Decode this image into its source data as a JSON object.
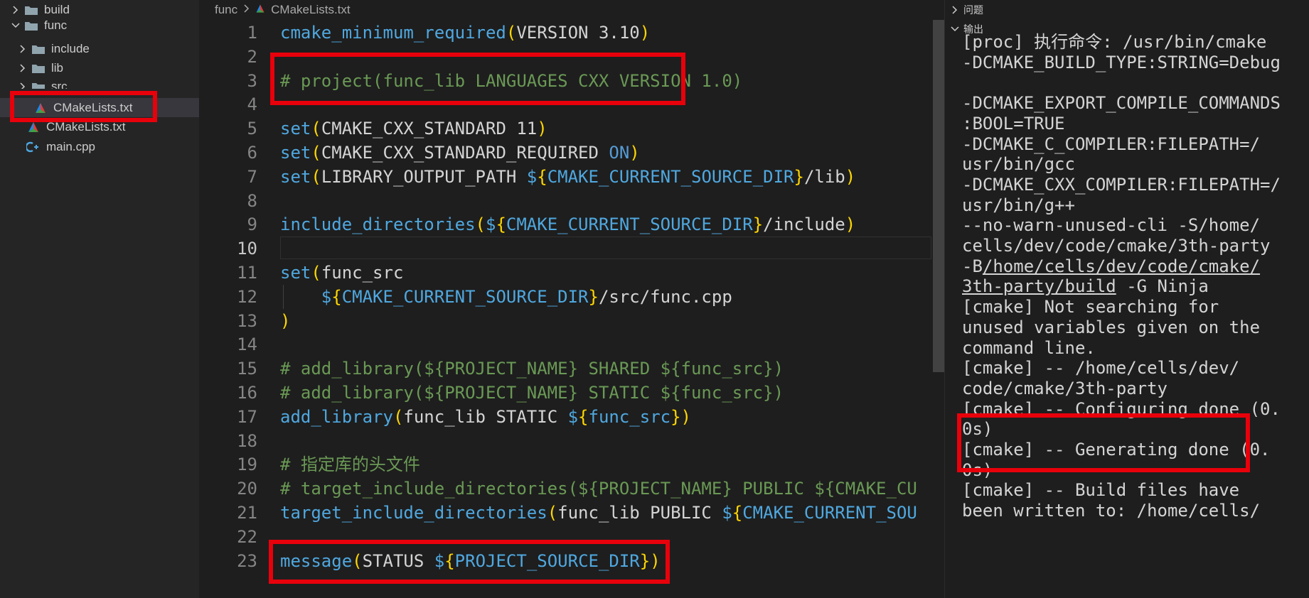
{
  "explorer": {
    "items": [
      {
        "label": "build",
        "type": "folder",
        "expanded": false
      },
      {
        "label": "func",
        "type": "folder",
        "expanded": true
      },
      {
        "label": "include",
        "type": "folder",
        "expanded": false
      },
      {
        "label": "lib",
        "type": "folder",
        "expanded": false
      },
      {
        "label": "src",
        "type": "folder",
        "expanded": false
      },
      {
        "label": "CMakeLists.txt",
        "type": "cmake-file",
        "selected": true
      },
      {
        "label": "CMakeLists.txt",
        "type": "cmake-file"
      },
      {
        "label": "main.cpp",
        "type": "cpp-file"
      }
    ]
  },
  "breadcrumb": {
    "folder": "func",
    "file": "CMakeLists.txt"
  },
  "editor": {
    "active_line": 10,
    "lines": [
      {
        "n": "1",
        "tokens": [
          [
            "fn",
            "cmake_minimum_required"
          ],
          [
            "p",
            "("
          ],
          [
            "tx",
            "VERSION 3.10"
          ],
          [
            "p",
            ")"
          ]
        ]
      },
      {
        "n": "2",
        "tokens": []
      },
      {
        "n": "3",
        "tokens": [
          [
            "cm",
            "# project(func_lib LANGUAGES CXX VERSION 1.0)"
          ]
        ]
      },
      {
        "n": "4",
        "tokens": []
      },
      {
        "n": "5",
        "tokens": [
          [
            "fn",
            "set"
          ],
          [
            "p",
            "("
          ],
          [
            "tx",
            "CMAKE_CXX_STANDARD 11"
          ],
          [
            "p",
            ")"
          ]
        ]
      },
      {
        "n": "6",
        "tokens": [
          [
            "fn",
            "set"
          ],
          [
            "p",
            "("
          ],
          [
            "tx",
            "CMAKE_CXX_STANDARD_REQUIRED "
          ],
          [
            "kw",
            "ON"
          ],
          [
            "p",
            ")"
          ]
        ]
      },
      {
        "n": "7",
        "tokens": [
          [
            "fn",
            "set"
          ],
          [
            "p",
            "("
          ],
          [
            "tx",
            "LIBRARY_OUTPUT_PATH "
          ],
          [
            "dl",
            "$"
          ],
          [
            "p",
            "{"
          ],
          [
            "var",
            "CMAKE_CURRENT_SOURCE_DIR"
          ],
          [
            "p",
            "}"
          ],
          [
            "tx",
            "/lib"
          ],
          [
            "p",
            ")"
          ]
        ]
      },
      {
        "n": "8",
        "tokens": []
      },
      {
        "n": "9",
        "tokens": [
          [
            "fn",
            "include_directories"
          ],
          [
            "p",
            "("
          ],
          [
            "dl",
            "$"
          ],
          [
            "p",
            "{"
          ],
          [
            "var",
            "CMAKE_CURRENT_SOURCE_DIR"
          ],
          [
            "p",
            "}"
          ],
          [
            "tx",
            "/include"
          ],
          [
            "p",
            ")"
          ]
        ]
      },
      {
        "n": "10",
        "tokens": []
      },
      {
        "n": "11",
        "tokens": [
          [
            "fn",
            "set"
          ],
          [
            "p",
            "("
          ],
          [
            "tx",
            "func_src"
          ]
        ]
      },
      {
        "n": "12",
        "tokens": [
          [
            "tx",
            "    "
          ],
          [
            "dl",
            "$"
          ],
          [
            "p",
            "{"
          ],
          [
            "var",
            "CMAKE_CURRENT_SOURCE_DIR"
          ],
          [
            "p",
            "}"
          ],
          [
            "tx",
            "/src/func.cpp"
          ]
        ]
      },
      {
        "n": "13",
        "tokens": [
          [
            "p",
            ")"
          ]
        ]
      },
      {
        "n": "14",
        "tokens": []
      },
      {
        "n": "15",
        "tokens": [
          [
            "cm",
            "# add_library(${PROJECT_NAME} SHARED ${func_src})"
          ]
        ]
      },
      {
        "n": "16",
        "tokens": [
          [
            "cm",
            "# add_library(${PROJECT_NAME} STATIC ${func_src})"
          ]
        ]
      },
      {
        "n": "17",
        "tokens": [
          [
            "fn",
            "add_library"
          ],
          [
            "p",
            "("
          ],
          [
            "tx",
            "func_lib STATIC "
          ],
          [
            "dl",
            "$"
          ],
          [
            "p",
            "{"
          ],
          [
            "var",
            "func_src"
          ],
          [
            "p",
            "}"
          ],
          [
            "p",
            ")"
          ]
        ]
      },
      {
        "n": "18",
        "tokens": []
      },
      {
        "n": "19",
        "tokens": [
          [
            "cm",
            "# 指定库的头文件"
          ]
        ]
      },
      {
        "n": "20",
        "tokens": [
          [
            "cm",
            "# target_include_directories(${PROJECT_NAME} PUBLIC ${CMAKE_CU"
          ]
        ]
      },
      {
        "n": "21",
        "tokens": [
          [
            "fn",
            "target_include_directories"
          ],
          [
            "p",
            "("
          ],
          [
            "tx",
            "func_lib PUBLIC "
          ],
          [
            "dl",
            "$"
          ],
          [
            "p",
            "{"
          ],
          [
            "var",
            "CMAKE_CURRENT_SOU"
          ]
        ]
      },
      {
        "n": "22",
        "tokens": []
      },
      {
        "n": "23",
        "tokens": [
          [
            "fn",
            "message"
          ],
          [
            "p",
            "("
          ],
          [
            "tx",
            "STATUS "
          ],
          [
            "dl",
            "$"
          ],
          [
            "p",
            "{"
          ],
          [
            "var",
            "PROJECT_SOURCE_DIR"
          ],
          [
            "p",
            "}"
          ],
          [
            "p",
            ")"
          ]
        ]
      }
    ]
  },
  "panel": {
    "problems_label": "问题",
    "output_label": "输出",
    "output_lines": [
      "[proc] 执行命令: /usr/bin/cmake",
      "-DCMAKE_BUILD_TYPE:STRING=Debug",
      "",
      "-DCMAKE_EXPORT_COMPILE_COMMANDS",
      ":BOOL=TRUE",
      "-DCMAKE_C_COMPILER:FILEPATH=/",
      "usr/bin/gcc",
      "-DCMAKE_CXX_COMPILER:FILEPATH=/",
      "usr/bin/g++",
      "--no-warn-unused-cli -S/home/",
      "cells/dev/code/cmake/3th-party",
      "-B/home/cells/dev/code/cmake/",
      "3th-party/build -G Ninja",
      "[cmake] Not searching for",
      "unused variables given on the",
      "command line.",
      "[cmake] -- /home/cells/dev/",
      "code/cmake/3th-party",
      "[cmake] -- Configuring done (0.",
      "0s)",
      "[cmake] -- Generating done (0.",
      "0s)",
      "[cmake] -- Build files have",
      "been written to: /home/cells/"
    ]
  },
  "colors": {
    "highlight": "#e8000b",
    "background": "#1e1e1e",
    "sidebar": "#252526"
  }
}
